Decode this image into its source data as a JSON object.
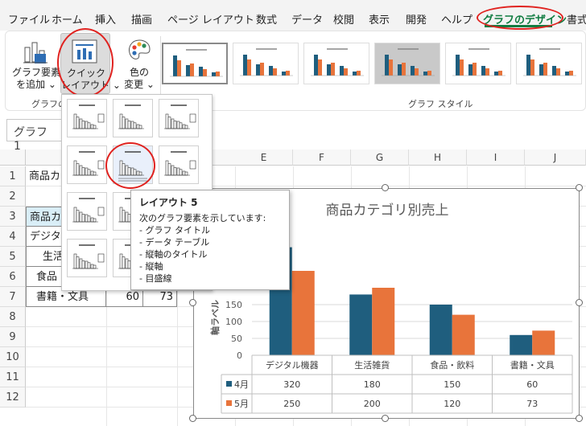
{
  "tabs": [
    "ファイル",
    "ホーム",
    "挿入",
    "描画",
    "ページ レイアウト",
    "数式",
    "データ",
    "校閲",
    "表示",
    "開発",
    "ヘルプ",
    "グラフのデザイン",
    "書式"
  ],
  "ribbon": {
    "add_element": [
      "グラフ要素",
      "を追加 ⌄"
    ],
    "quick_layout": [
      "クイック",
      "レイアウト ⌄"
    ],
    "change_color": [
      "色の",
      "変更 ⌄"
    ],
    "group1_label": "グラフのレ",
    "styles_label": "グラフ スタイル"
  },
  "namebox": "グラフ 1",
  "columns": [
    "E",
    "F",
    "G",
    "H",
    "I",
    "J"
  ],
  "rows": [
    "1",
    "2",
    "3",
    "4",
    "5",
    "6",
    "7",
    "8",
    "9",
    "10",
    "11",
    "12"
  ],
  "cells": {
    "a1": "商品カ",
    "a3": "商品カ",
    "a4": "デジタ",
    "a5": "生活",
    "a6": "食品",
    "a7": "書籍・文具",
    "b7": "60",
    "c7": "73"
  },
  "tooltip": {
    "title": "レイアウト 5",
    "intro": "次のグラフ要素を示しています:",
    "items": [
      "- グラフ タイトル",
      "- データ テーブル",
      "- 縦軸のタイトル",
      "- 縦軸",
      "- 目盛線"
    ]
  },
  "chart_data": {
    "type": "bar",
    "title": "商品カテゴリ別売上",
    "ylabel": "軸ラベル",
    "categories": [
      "デジタル機器",
      "生活雑貨",
      "食品・飲料",
      "書籍・文具"
    ],
    "series": [
      {
        "name": "4月",
        "values": [
          320,
          180,
          150,
          60
        ],
        "color": "#1f5e7e"
      },
      {
        "name": "5月",
        "values": [
          250,
          200,
          120,
          73
        ],
        "color": "#e8743b"
      }
    ],
    "yticks": [
      0,
      50,
      100,
      150
    ],
    "ylim": [
      0,
      350
    ],
    "grid": true,
    "table": true
  }
}
